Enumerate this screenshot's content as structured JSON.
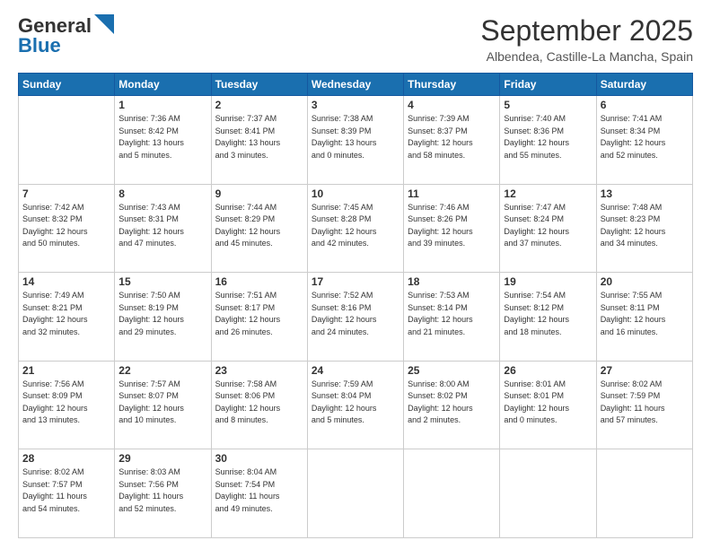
{
  "header": {
    "logo_line1": "General",
    "logo_line2": "Blue",
    "month": "September 2025",
    "location": "Albendea, Castille-La Mancha, Spain"
  },
  "days_of_week": [
    "Sunday",
    "Monday",
    "Tuesday",
    "Wednesday",
    "Thursday",
    "Friday",
    "Saturday"
  ],
  "weeks": [
    [
      {
        "day": "",
        "info": ""
      },
      {
        "day": "1",
        "info": "Sunrise: 7:36 AM\nSunset: 8:42 PM\nDaylight: 13 hours\nand 5 minutes."
      },
      {
        "day": "2",
        "info": "Sunrise: 7:37 AM\nSunset: 8:41 PM\nDaylight: 13 hours\nand 3 minutes."
      },
      {
        "day": "3",
        "info": "Sunrise: 7:38 AM\nSunset: 8:39 PM\nDaylight: 13 hours\nand 0 minutes."
      },
      {
        "day": "4",
        "info": "Sunrise: 7:39 AM\nSunset: 8:37 PM\nDaylight: 12 hours\nand 58 minutes."
      },
      {
        "day": "5",
        "info": "Sunrise: 7:40 AM\nSunset: 8:36 PM\nDaylight: 12 hours\nand 55 minutes."
      },
      {
        "day": "6",
        "info": "Sunrise: 7:41 AM\nSunset: 8:34 PM\nDaylight: 12 hours\nand 52 minutes."
      }
    ],
    [
      {
        "day": "7",
        "info": "Sunrise: 7:42 AM\nSunset: 8:32 PM\nDaylight: 12 hours\nand 50 minutes."
      },
      {
        "day": "8",
        "info": "Sunrise: 7:43 AM\nSunset: 8:31 PM\nDaylight: 12 hours\nand 47 minutes."
      },
      {
        "day": "9",
        "info": "Sunrise: 7:44 AM\nSunset: 8:29 PM\nDaylight: 12 hours\nand 45 minutes."
      },
      {
        "day": "10",
        "info": "Sunrise: 7:45 AM\nSunset: 8:28 PM\nDaylight: 12 hours\nand 42 minutes."
      },
      {
        "day": "11",
        "info": "Sunrise: 7:46 AM\nSunset: 8:26 PM\nDaylight: 12 hours\nand 39 minutes."
      },
      {
        "day": "12",
        "info": "Sunrise: 7:47 AM\nSunset: 8:24 PM\nDaylight: 12 hours\nand 37 minutes."
      },
      {
        "day": "13",
        "info": "Sunrise: 7:48 AM\nSunset: 8:23 PM\nDaylight: 12 hours\nand 34 minutes."
      }
    ],
    [
      {
        "day": "14",
        "info": "Sunrise: 7:49 AM\nSunset: 8:21 PM\nDaylight: 12 hours\nand 32 minutes."
      },
      {
        "day": "15",
        "info": "Sunrise: 7:50 AM\nSunset: 8:19 PM\nDaylight: 12 hours\nand 29 minutes."
      },
      {
        "day": "16",
        "info": "Sunrise: 7:51 AM\nSunset: 8:17 PM\nDaylight: 12 hours\nand 26 minutes."
      },
      {
        "day": "17",
        "info": "Sunrise: 7:52 AM\nSunset: 8:16 PM\nDaylight: 12 hours\nand 24 minutes."
      },
      {
        "day": "18",
        "info": "Sunrise: 7:53 AM\nSunset: 8:14 PM\nDaylight: 12 hours\nand 21 minutes."
      },
      {
        "day": "19",
        "info": "Sunrise: 7:54 AM\nSunset: 8:12 PM\nDaylight: 12 hours\nand 18 minutes."
      },
      {
        "day": "20",
        "info": "Sunrise: 7:55 AM\nSunset: 8:11 PM\nDaylight: 12 hours\nand 16 minutes."
      }
    ],
    [
      {
        "day": "21",
        "info": "Sunrise: 7:56 AM\nSunset: 8:09 PM\nDaylight: 12 hours\nand 13 minutes."
      },
      {
        "day": "22",
        "info": "Sunrise: 7:57 AM\nSunset: 8:07 PM\nDaylight: 12 hours\nand 10 minutes."
      },
      {
        "day": "23",
        "info": "Sunrise: 7:58 AM\nSunset: 8:06 PM\nDaylight: 12 hours\nand 8 minutes."
      },
      {
        "day": "24",
        "info": "Sunrise: 7:59 AM\nSunset: 8:04 PM\nDaylight: 12 hours\nand 5 minutes."
      },
      {
        "day": "25",
        "info": "Sunrise: 8:00 AM\nSunset: 8:02 PM\nDaylight: 12 hours\nand 2 minutes."
      },
      {
        "day": "26",
        "info": "Sunrise: 8:01 AM\nSunset: 8:01 PM\nDaylight: 12 hours\nand 0 minutes."
      },
      {
        "day": "27",
        "info": "Sunrise: 8:02 AM\nSunset: 7:59 PM\nDaylight: 11 hours\nand 57 minutes."
      }
    ],
    [
      {
        "day": "28",
        "info": "Sunrise: 8:02 AM\nSunset: 7:57 PM\nDaylight: 11 hours\nand 54 minutes."
      },
      {
        "day": "29",
        "info": "Sunrise: 8:03 AM\nSunset: 7:56 PM\nDaylight: 11 hours\nand 52 minutes."
      },
      {
        "day": "30",
        "info": "Sunrise: 8:04 AM\nSunset: 7:54 PM\nDaylight: 11 hours\nand 49 minutes."
      },
      {
        "day": "",
        "info": ""
      },
      {
        "day": "",
        "info": ""
      },
      {
        "day": "",
        "info": ""
      },
      {
        "day": "",
        "info": ""
      }
    ]
  ]
}
